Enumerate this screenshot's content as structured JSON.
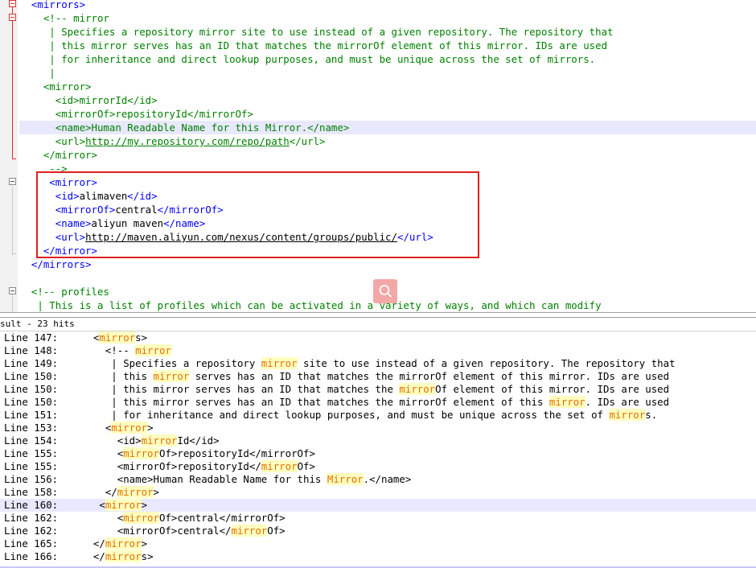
{
  "editor": {
    "lines": [
      {
        "parts": [
          {
            "c": "tag",
            "t": "  <mirrors>"
          }
        ]
      },
      {
        "parts": [
          {
            "c": "cmt",
            "t": "    <!-- mirror"
          }
        ]
      },
      {
        "parts": [
          {
            "c": "cmt",
            "t": "     | Specifies a repository mirror site to use instead of a given repository. The repository that"
          }
        ]
      },
      {
        "parts": [
          {
            "c": "cmt",
            "t": "     | this mirror serves has an ID that matches the mirrorOf element of this mirror. IDs are used"
          }
        ]
      },
      {
        "parts": [
          {
            "c": "cmt",
            "t": "     | for inheritance and direct lookup purposes, and must be unique across the set of mirrors."
          }
        ]
      },
      {
        "parts": [
          {
            "c": "cmt",
            "t": "     |"
          }
        ]
      },
      {
        "parts": [
          {
            "c": "cmt",
            "t": "    <mirror>"
          }
        ]
      },
      {
        "parts": [
          {
            "c": "cmt",
            "t": "      <id>mirrorId</id>"
          }
        ]
      },
      {
        "parts": [
          {
            "c": "cmt",
            "t": "      <mirrorOf>repositoryId</mirrorOf>"
          }
        ]
      },
      {
        "hl": true,
        "parts": [
          {
            "c": "cmt",
            "t": "      <name>Human Readable Name for this Mirror.</name>"
          }
        ]
      },
      {
        "parts": [
          {
            "c": "cmt",
            "t": "      <url>"
          },
          {
            "c": "cmt lnk-g",
            "t": "http://my.repository.com/repo/path"
          },
          {
            "c": "cmt",
            "t": "</url>"
          }
        ]
      },
      {
        "parts": [
          {
            "c": "cmt",
            "t": "    </mirror>"
          }
        ]
      },
      {
        "parts": [
          {
            "c": "cmt",
            "t": "     -->"
          }
        ]
      },
      {
        "parts": [
          {
            "c": "tag",
            "t": "     <mirror>"
          }
        ]
      },
      {
        "parts": [
          {
            "c": "tag",
            "t": "      <id>"
          },
          {
            "c": "txt",
            "t": "alimaven"
          },
          {
            "c": "tag",
            "t": "</id>"
          }
        ]
      },
      {
        "parts": [
          {
            "c": "tag",
            "t": "      <mirrorOf>"
          },
          {
            "c": "txt",
            "t": "central"
          },
          {
            "c": "tag",
            "t": "</mirrorOf>"
          }
        ]
      },
      {
        "parts": [
          {
            "c": "tag",
            "t": "      <name>"
          },
          {
            "c": "txt",
            "t": "aliyun maven"
          },
          {
            "c": "tag",
            "t": "</name>"
          }
        ]
      },
      {
        "parts": [
          {
            "c": "tag",
            "t": "      <url>"
          },
          {
            "c": "lnk",
            "t": "http://maven.aliyun.com/nexus/content/groups/public/"
          },
          {
            "c": "tag",
            "t": "</url>"
          }
        ]
      },
      {
        "parts": [
          {
            "c": "tag",
            "t": "    </mirror>"
          }
        ]
      },
      {
        "parts": [
          {
            "c": "tag",
            "t": "  </mirrors>"
          }
        ]
      },
      {
        "parts": [
          {
            "c": "txt",
            "t": ""
          }
        ]
      },
      {
        "parts": [
          {
            "c": "cmt",
            "t": "  <!-- profiles"
          }
        ]
      },
      {
        "parts": [
          {
            "c": "cmt",
            "t": "   | This is a list of profiles which can be activated in a variety of ways, and which can modify"
          }
        ]
      }
    ]
  },
  "results": {
    "header": "sult - 23 hits",
    "rows": [
      {
        "line": "Line 147:",
        "parts": [
          {
            "t": "  <"
          },
          {
            "m": "mirror"
          },
          {
            "t": "s>"
          }
        ]
      },
      {
        "line": "Line 148:",
        "parts": [
          {
            "t": "    <!-- "
          },
          {
            "m": "mirror"
          }
        ]
      },
      {
        "line": "Line 149:",
        "parts": [
          {
            "t": "     | Specifies a repository "
          },
          {
            "m": "mirror"
          },
          {
            "t": " site to use instead of a given repository. The repository that"
          }
        ]
      },
      {
        "line": "Line 150:",
        "parts": [
          {
            "t": "     | this "
          },
          {
            "m": "mirror"
          },
          {
            "t": " serves has an ID that matches the mirrorOf element of this mirror. IDs are used"
          }
        ]
      },
      {
        "line": "Line 150:",
        "parts": [
          {
            "t": "     | this mirror serves has an ID that matches the "
          },
          {
            "m": "mirror"
          },
          {
            "t": "Of element of this mirror. IDs are used"
          }
        ]
      },
      {
        "line": "Line 150:",
        "parts": [
          {
            "t": "     | this mirror serves has an ID that matches the mirrorOf element of this "
          },
          {
            "m": "mirror"
          },
          {
            "t": ". IDs are used"
          }
        ]
      },
      {
        "line": "Line 151:",
        "parts": [
          {
            "t": "     | for inheritance and direct lookup purposes, and must be unique across the set of "
          },
          {
            "m": "mirror"
          },
          {
            "t": "s."
          }
        ]
      },
      {
        "line": "Line 153:",
        "parts": [
          {
            "t": "    <"
          },
          {
            "m": "mirror"
          },
          {
            "t": ">"
          }
        ]
      },
      {
        "line": "Line 154:",
        "parts": [
          {
            "t": "      <id>"
          },
          {
            "m": "mirror"
          },
          {
            "t": "Id</id>"
          }
        ]
      },
      {
        "line": "Line 155:",
        "parts": [
          {
            "t": "      <"
          },
          {
            "m": "mirror"
          },
          {
            "t": "Of>repositoryId</mirrorOf>"
          }
        ]
      },
      {
        "line": "Line 155:",
        "parts": [
          {
            "t": "      <mirrorOf>repositoryId</"
          },
          {
            "m": "mirror"
          },
          {
            "t": "Of>"
          }
        ]
      },
      {
        "line": "Line 156:",
        "parts": [
          {
            "t": "      <name>Human Readable Name for this "
          },
          {
            "m": "Mirror"
          },
          {
            "t": ".</name>"
          }
        ]
      },
      {
        "line": "Line 158:",
        "parts": [
          {
            "t": "    </"
          },
          {
            "m": "mirror"
          },
          {
            "t": ">"
          }
        ]
      },
      {
        "line": "Line 160:",
        "hl": true,
        "parts": [
          {
            "t": "   <"
          },
          {
            "m": "mirror"
          },
          {
            "t": ">"
          }
        ]
      },
      {
        "line": "Line 162:",
        "parts": [
          {
            "t": "      <"
          },
          {
            "m": "mirror"
          },
          {
            "t": "Of>central</mirrorOf>"
          }
        ]
      },
      {
        "line": "Line 162:",
        "parts": [
          {
            "t": "      <mirrorOf>central</"
          },
          {
            "m": "mirror"
          },
          {
            "t": "Of>"
          }
        ]
      },
      {
        "line": "Line 165:",
        "parts": [
          {
            "t": "  </"
          },
          {
            "m": "mirror"
          },
          {
            "t": ">"
          }
        ]
      },
      {
        "line": "Line 166:",
        "parts": [
          {
            "t": "  </"
          },
          {
            "m": "mirror"
          },
          {
            "t": "s>"
          }
        ]
      }
    ]
  }
}
